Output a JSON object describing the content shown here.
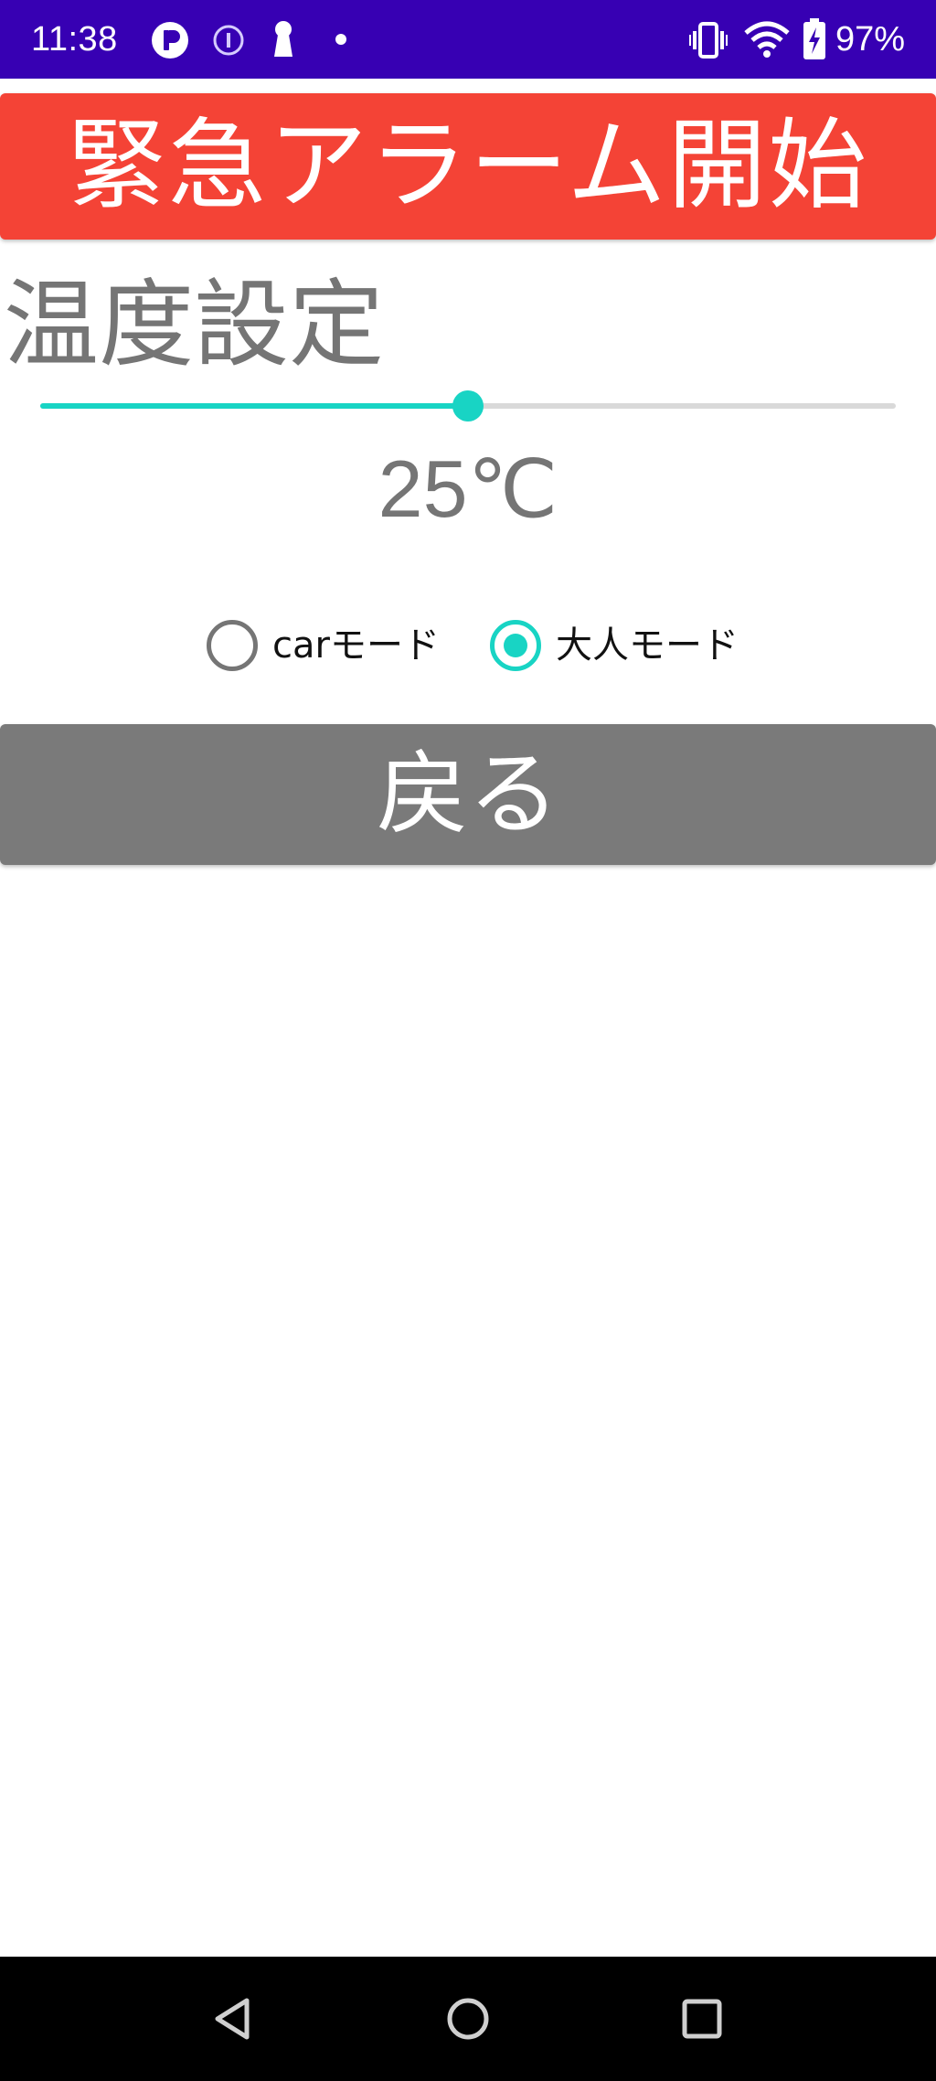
{
  "status_bar": {
    "time": "11:38",
    "battery": "97%",
    "icons": [
      "app-icon",
      "info-icon",
      "keyhole-icon",
      "dot-icon",
      "vibrate-icon",
      "wifi-icon",
      "battery-charging-icon"
    ],
    "background": "#3700b3"
  },
  "alarm_button": {
    "label": "緊急アラーム開始",
    "color": "#f44336"
  },
  "temperature": {
    "title": "温度設定",
    "value_label": "25℃",
    "slider_fraction": 0.5,
    "accent": "#18d4c4"
  },
  "modes": {
    "options": [
      {
        "label": "carモード",
        "checked": false
      },
      {
        "label": "大人モード",
        "checked": true
      }
    ]
  },
  "back_button": {
    "label": "戻る",
    "color": "#7a7a7a"
  },
  "nav_bar": {
    "icons": [
      "back-triangle-icon",
      "home-circle-icon",
      "recents-square-icon"
    ]
  }
}
